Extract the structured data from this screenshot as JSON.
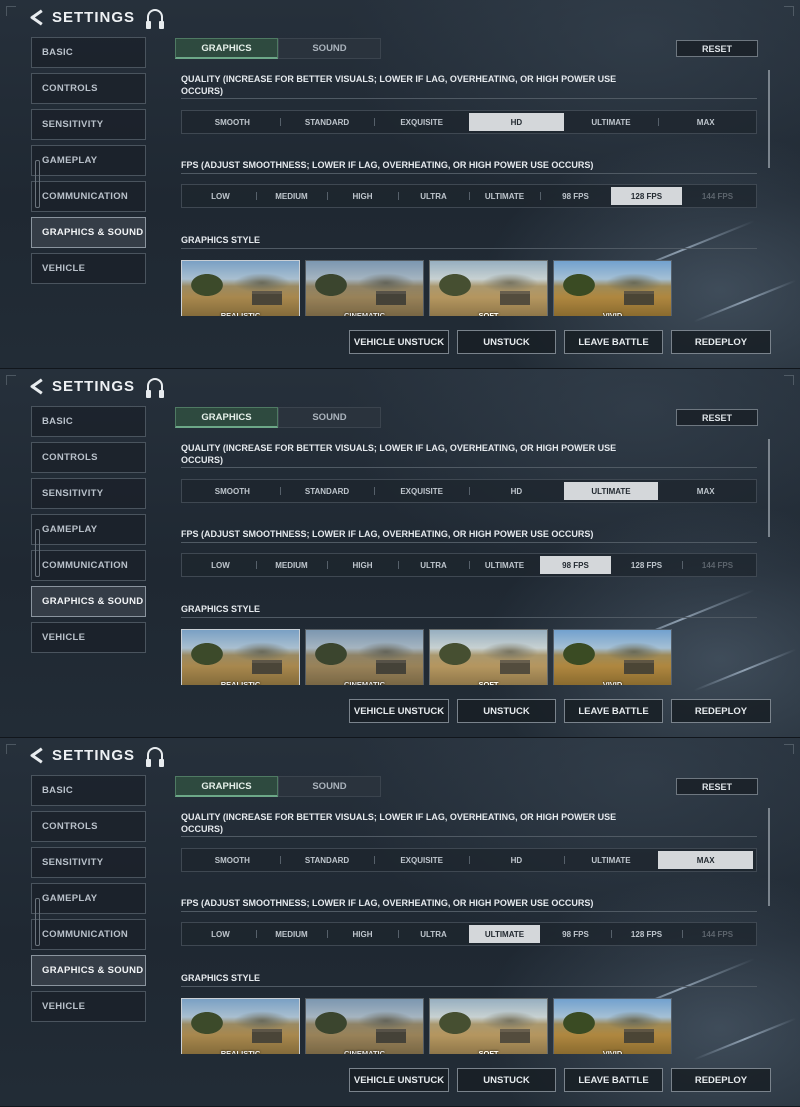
{
  "header": {
    "title": "SETTINGS",
    "back_icon": "back-arrow-icon",
    "voice_icon": "headset-icon"
  },
  "sidebar": {
    "items": [
      {
        "label": "BASIC"
      },
      {
        "label": "CONTROLS"
      },
      {
        "label": "SENSITIVITY"
      },
      {
        "label": "GAMEPLAY"
      },
      {
        "label": "COMMUNICATION"
      },
      {
        "label": "GRAPHICS & SOUND"
      },
      {
        "label": "VEHICLE"
      }
    ],
    "active_index": 5
  },
  "tabs": [
    {
      "label": "GRAPHICS"
    },
    {
      "label": "SOUND"
    }
  ],
  "active_tab": 0,
  "reset_label": "RESET",
  "quality": {
    "title": "QUALITY (INCREASE FOR BETTER VISUALS; LOWER IF LAG, OVERHEATING, OR HIGH POWER USE OCCURS)",
    "options": [
      "SMOOTH",
      "STANDARD",
      "EXQUISITE",
      "HD",
      "ULTIMATE",
      "MAX"
    ]
  },
  "fps": {
    "title": "FPS (ADJUST SMOOTHNESS; LOWER IF LAG, OVERHEATING, OR HIGH POWER USE OCCURS)",
    "options": [
      "LOW",
      "MEDIUM",
      "HIGH",
      "ULTRA",
      "ULTIMATE",
      "98 FPS",
      "128 FPS",
      "144 FPS"
    ],
    "disabled": [
      "144 FPS"
    ]
  },
  "graphics_style": {
    "title": "GRAPHICS STYLE",
    "options": [
      "REALISTIC",
      "CINEMATIC",
      "SOFT",
      "VIVID"
    ],
    "selected": "REALISTIC"
  },
  "actions": [
    "VEHICLE UNSTUCK",
    "UNSTUCK",
    "LEAVE BATTLE",
    "REDEPLOY"
  ],
  "panels": [
    {
      "quality_selected": "HD",
      "fps_selected": "128 FPS"
    },
    {
      "quality_selected": "ULTIMATE",
      "fps_selected": "98 FPS"
    },
    {
      "quality_selected": "MAX",
      "fps_selected": "ULTIMATE"
    }
  ],
  "colors": {
    "selected_option_bg": "#d4d7da",
    "active_tab_bg": "#2e4a3f",
    "active_tab_underline": "#6da888",
    "disabled_text": "#5c646c"
  }
}
